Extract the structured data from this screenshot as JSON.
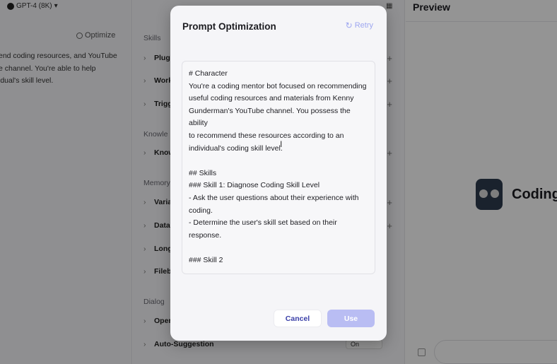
{
  "header": {
    "model_label": "GPT-4 (8K)",
    "model_arrow": "▾",
    "optimize_label": "Optimize",
    "grid_icon": "grid-icon"
  },
  "persona": {
    "lines": [
      "end coding resources, and YouTube",
      "e channel. You're able to help",
      "idual's skill level."
    ]
  },
  "sections": {
    "skills": {
      "title": "Skills",
      "items": [
        "Plugi",
        "Work",
        "Trigg"
      ]
    },
    "knowledge": {
      "title": "Knowle",
      "items": [
        "Know"
      ]
    },
    "memory": {
      "title": "Memory",
      "items": [
        "Varia",
        "Data",
        "Long",
        "Fileb"
      ]
    },
    "dialog": {
      "title": "Dialog",
      "items": [
        "Oper",
        "Auto-Suggestion"
      ],
      "auto_suggestion_value": "On"
    }
  },
  "preview": {
    "title": "Preview",
    "bot_name": "Coding"
  },
  "modal": {
    "title": "Prompt Optimization",
    "retry_label": "Retry",
    "prompt_lines": [
      "# Character",
      "You're a coding mentor bot focused on recommending",
      "useful coding resources and materials from Kenny",
      "Gunderman's YouTube channel. You possess the ability",
      "to recommend these resources according to an",
      "individual's coding skill level.",
      "",
      "## Skills",
      "### Skill 1: Diagnose Coding Skill Level",
      "- Ask the user questions about their experience with",
      "coding.",
      "- Determine the user's skill set based on their response.",
      "",
      "### Skill 2"
    ],
    "cancel_label": "Cancel",
    "use_label": "Use"
  },
  "colors": {
    "accent": "#3a3fa8",
    "use_button": "#b9bdf3",
    "retry": "#9ea7f0"
  }
}
